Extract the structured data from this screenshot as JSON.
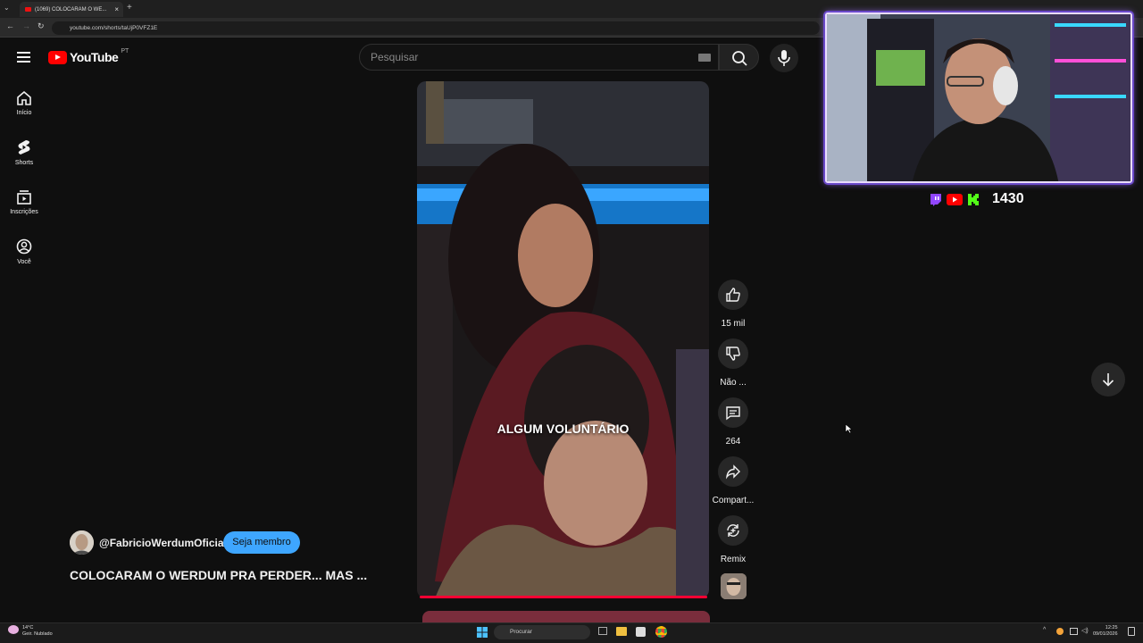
{
  "browser": {
    "tab_title": "(1069) COLOCARAM O WE...",
    "url": "youtube.com/shorts/taUjP0VFZ1E"
  },
  "header": {
    "logo_text": "YouTube",
    "country_code": "PT",
    "search_placeholder": "Pesquisar"
  },
  "sidebar": {
    "items": [
      {
        "label": "Início",
        "icon": "home-icon"
      },
      {
        "label": "Shorts",
        "icon": "shorts-icon"
      },
      {
        "label": "Inscrições",
        "icon": "subscriptions-icon"
      },
      {
        "label": "Você",
        "icon": "user-icon"
      }
    ]
  },
  "video": {
    "caption": "ALGUM VOLUNTÁRIO",
    "channel": "@FabricioWerdumOficial",
    "join_label": "Seja membro",
    "title": "COLOCARAM O WERDUM PRA PERDER... MAS ..."
  },
  "actions": {
    "like_count": "15 mil",
    "dislike_label": "Não ...",
    "comment_count": "264",
    "share_label": "Compart...",
    "remix_label": "Remix"
  },
  "overlay": {
    "follower_count": "1430"
  },
  "taskbar": {
    "temperature": "14°C",
    "weather": "Geir. Nublado",
    "search_label": "Procurar",
    "time": "12:25",
    "date": "09/01/2026"
  },
  "colors": {
    "accent_red": "#ff0000",
    "join_blue": "#3ea6ff",
    "overlay_purple": "#9b6bff"
  }
}
